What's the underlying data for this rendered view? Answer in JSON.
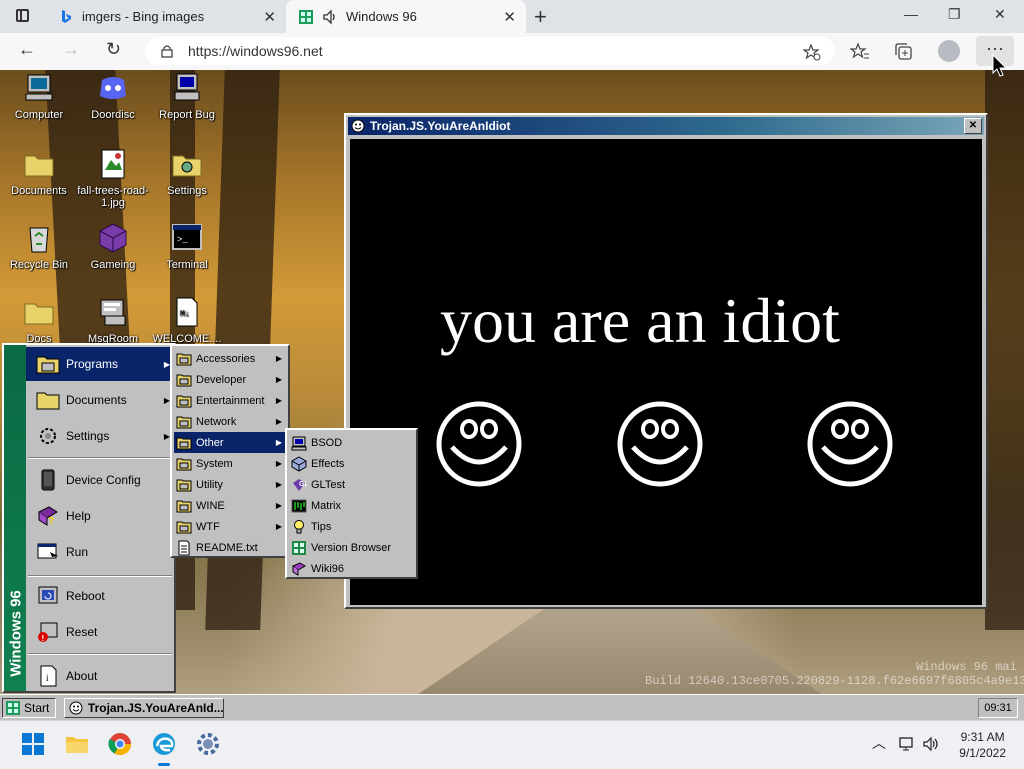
{
  "browser": {
    "tabs": [
      {
        "title": "imgers - Bing images",
        "icon": "bing-icon"
      },
      {
        "title": "Windows 96",
        "icon": "windows96-icon",
        "muted": false
      }
    ],
    "new_tab_glyph": "+",
    "url": "https://windows96.net",
    "accent": "#0a246a"
  },
  "desktop": {
    "icons": [
      {
        "label": "Computer",
        "icon": "computer-icon"
      },
      {
        "label": "Doordisc",
        "icon": "discord-icon"
      },
      {
        "label": "Report Bug",
        "icon": "report-bug-icon"
      },
      {
        "label": "Documents",
        "icon": "folder-icon"
      },
      {
        "label": "fall-trees-road-1.jpg",
        "icon": "image-file-icon"
      },
      {
        "label": "Settings",
        "icon": "settings-folder-icon"
      },
      {
        "label": "Recycle Bin",
        "icon": "recycle-bin-icon"
      },
      {
        "label": "Gameing",
        "icon": "game-icon"
      },
      {
        "label": "Terminal",
        "icon": "terminal-icon"
      },
      {
        "label": "Docs",
        "icon": "folder-icon"
      },
      {
        "label": "MsgRoom",
        "icon": "msgroom-icon"
      },
      {
        "label": "WELCOME....",
        "icon": "document-icon"
      }
    ],
    "watermark_line1": "Windows 96 mai",
    "watermark_line2": "Build 12640.13ce0705.220829-1128.f62e6697f6805c4a9e13"
  },
  "trojan_window": {
    "title": "Trojan.JS.YouAreAnIdiot",
    "message": "you are an idiot",
    "faces": 3
  },
  "start_menu": {
    "brand": "Windows 96",
    "items": [
      {
        "label": "Programs",
        "icon": "programs-icon",
        "submenu": true
      },
      {
        "label": "Documents",
        "icon": "documents-icon",
        "submenu": true
      },
      {
        "label": "Settings",
        "icon": "settings-icon",
        "submenu": true
      },
      {
        "label": "Device Config",
        "icon": "device-config-icon"
      },
      {
        "label": "Help",
        "icon": "help-icon"
      },
      {
        "label": "Run",
        "icon": "run-icon"
      },
      {
        "label": "Reboot",
        "icon": "reboot-icon"
      },
      {
        "label": "Reset",
        "icon": "reset-icon"
      },
      {
        "label": "About",
        "icon": "about-icon"
      }
    ],
    "programs": [
      {
        "label": "Accessories"
      },
      {
        "label": "Developer"
      },
      {
        "label": "Entertainment"
      },
      {
        "label": "Network"
      },
      {
        "label": "Other"
      },
      {
        "label": "System"
      },
      {
        "label": "Utility"
      },
      {
        "label": "WINE"
      },
      {
        "label": "WTF"
      },
      {
        "label": "README.txt",
        "file": true
      }
    ],
    "other": [
      {
        "label": "BSOD",
        "icon": "bsod-icon"
      },
      {
        "label": "Effects",
        "icon": "effects-icon"
      },
      {
        "label": "GLTest",
        "icon": "gltest-icon"
      },
      {
        "label": "Matrix",
        "icon": "matrix-icon"
      },
      {
        "label": "Tips",
        "icon": "tips-icon"
      },
      {
        "label": "Version Browser",
        "icon": "version-browser-icon"
      },
      {
        "label": "Wiki96",
        "icon": "wiki96-icon"
      }
    ]
  },
  "taskbar": {
    "start_label": "Start",
    "task_label": "Trojan.JS.YouAreAnId...",
    "clock": "09:31"
  },
  "host_taskbar": {
    "time": "9:31 AM",
    "date": "9/1/2022"
  }
}
